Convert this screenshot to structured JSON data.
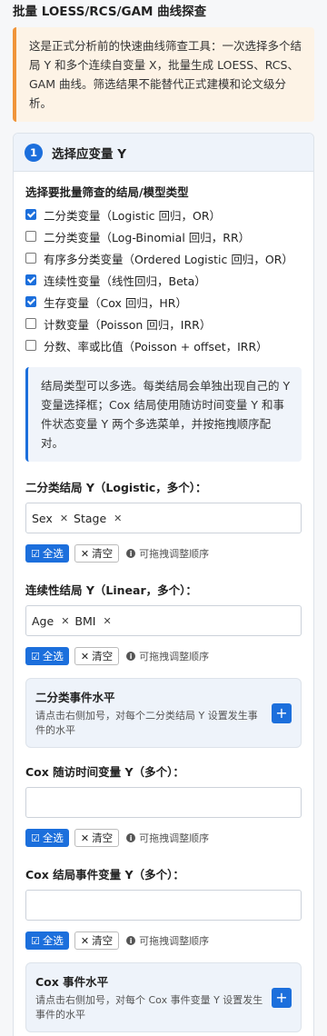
{
  "page": {
    "title": "批量 LOESS/RCS/GAM 曲线探查"
  },
  "warning": {
    "text": "这是正式分析前的快速曲线筛查工具：一次选择多个结局 Y 和多个连续自变量 X，批量生成 LOESS、RCS、GAM 曲线。筛选结果不能替代正式建模和论文级分析。"
  },
  "step1": {
    "number": "1",
    "title": "选择应变量 Y",
    "outcome_types_label": "选择要批量筛查的结局/模型类型",
    "outcome_types": [
      {
        "label": "二分类变量（Logistic 回归，OR）",
        "checked": true
      },
      {
        "label": "二分类变量（Log-Binomial 回归，RR）",
        "checked": false
      },
      {
        "label": "有序多分类变量（Ordered Logistic 回归，OR）",
        "checked": false
      },
      {
        "label": "连续性变量（线性回归，Beta）",
        "checked": true
      },
      {
        "label": "生存变量（Cox 回归，HR）",
        "checked": true
      },
      {
        "label": "计数变量（Poisson 回归，IRR）",
        "checked": false
      },
      {
        "label": "分数、率或比值（Poisson + offset，IRR）",
        "checked": false
      }
    ],
    "info": "结局类型可以多选。每类结局会单独出现自己的 Y 变量选择框；Cox 结局使用随访时间变量 Y 和事件状态变量 Y 两个多选菜单，并按拖拽顺序配对。",
    "fields": [
      {
        "label": "二分类结局 Y（Logistic，多个）：",
        "tags": [
          "Sex",
          "Stage"
        ]
      },
      {
        "label": "连续性结局 Y（Linear，多个）：",
        "tags": [
          "Age",
          "BMI"
        ]
      },
      {
        "label": "Cox 随访时间变量 Y（多个）：",
        "tags": []
      },
      {
        "label": "Cox 结局事件变量 Y（多个）：",
        "tags": []
      }
    ],
    "actions": {
      "select_all": "全选",
      "clear": "清空",
      "hint": "可拖拽调整顺序"
    },
    "binary_event_panel": {
      "title": "二分类事件水平",
      "desc": "请点击右侧加号，对每个二分类结局 Y 设置发生事件的水平",
      "plus": "+"
    },
    "cox_event_panel": {
      "title": "Cox 事件水平",
      "desc": "请点击右侧加号，对每个 Cox 事件变量 Y 设置发生事件的水平",
      "plus": "+"
    }
  },
  "icons": {
    "select_all": "checkbox-icon",
    "clear": "close-icon",
    "hint": "info-icon",
    "remove_tag": "close-icon"
  },
  "colors": {
    "primary": "#1c6fdc",
    "warning_border": "#f0953a",
    "warning_bg": "#fdf3e6",
    "info_bg": "#f0f4fa"
  }
}
